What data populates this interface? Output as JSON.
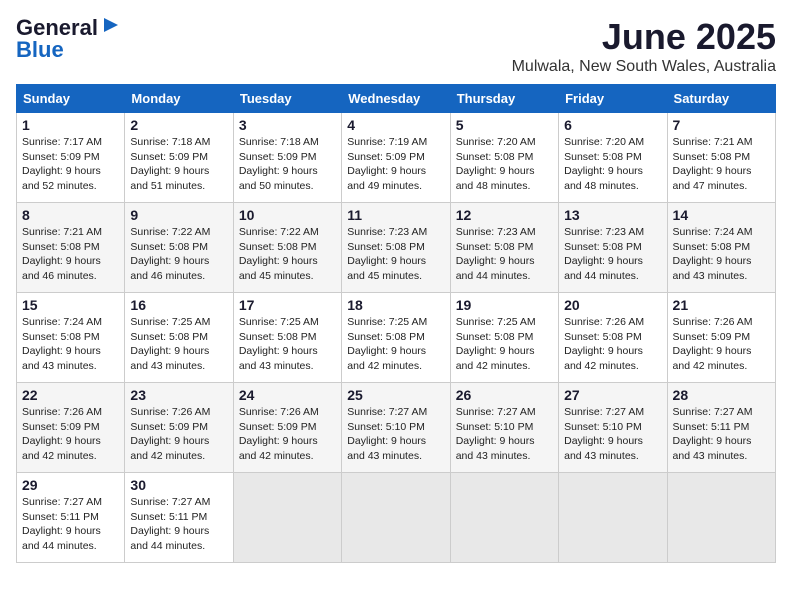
{
  "logo": {
    "general": "General",
    "blue": "Blue"
  },
  "title": "June 2025",
  "location": "Mulwala, New South Wales, Australia",
  "headers": [
    "Sunday",
    "Monday",
    "Tuesday",
    "Wednesday",
    "Thursday",
    "Friday",
    "Saturday"
  ],
  "weeks": [
    [
      {
        "day": "1",
        "sunrise": "7:17 AM",
        "sunset": "5:09 PM",
        "daylight": "9 hours and 52 minutes."
      },
      {
        "day": "2",
        "sunrise": "7:18 AM",
        "sunset": "5:09 PM",
        "daylight": "9 hours and 51 minutes."
      },
      {
        "day": "3",
        "sunrise": "7:18 AM",
        "sunset": "5:09 PM",
        "daylight": "9 hours and 50 minutes."
      },
      {
        "day": "4",
        "sunrise": "7:19 AM",
        "sunset": "5:09 PM",
        "daylight": "9 hours and 49 minutes."
      },
      {
        "day": "5",
        "sunrise": "7:20 AM",
        "sunset": "5:08 PM",
        "daylight": "9 hours and 48 minutes."
      },
      {
        "day": "6",
        "sunrise": "7:20 AM",
        "sunset": "5:08 PM",
        "daylight": "9 hours and 48 minutes."
      },
      {
        "day": "7",
        "sunrise": "7:21 AM",
        "sunset": "5:08 PM",
        "daylight": "9 hours and 47 minutes."
      }
    ],
    [
      {
        "day": "8",
        "sunrise": "7:21 AM",
        "sunset": "5:08 PM",
        "daylight": "9 hours and 46 minutes."
      },
      {
        "day": "9",
        "sunrise": "7:22 AM",
        "sunset": "5:08 PM",
        "daylight": "9 hours and 46 minutes."
      },
      {
        "day": "10",
        "sunrise": "7:22 AM",
        "sunset": "5:08 PM",
        "daylight": "9 hours and 45 minutes."
      },
      {
        "day": "11",
        "sunrise": "7:23 AM",
        "sunset": "5:08 PM",
        "daylight": "9 hours and 45 minutes."
      },
      {
        "day": "12",
        "sunrise": "7:23 AM",
        "sunset": "5:08 PM",
        "daylight": "9 hours and 44 minutes."
      },
      {
        "day": "13",
        "sunrise": "7:23 AM",
        "sunset": "5:08 PM",
        "daylight": "9 hours and 44 minutes."
      },
      {
        "day": "14",
        "sunrise": "7:24 AM",
        "sunset": "5:08 PM",
        "daylight": "9 hours and 43 minutes."
      }
    ],
    [
      {
        "day": "15",
        "sunrise": "7:24 AM",
        "sunset": "5:08 PM",
        "daylight": "9 hours and 43 minutes."
      },
      {
        "day": "16",
        "sunrise": "7:25 AM",
        "sunset": "5:08 PM",
        "daylight": "9 hours and 43 minutes."
      },
      {
        "day": "17",
        "sunrise": "7:25 AM",
        "sunset": "5:08 PM",
        "daylight": "9 hours and 43 minutes."
      },
      {
        "day": "18",
        "sunrise": "7:25 AM",
        "sunset": "5:08 PM",
        "daylight": "9 hours and 42 minutes."
      },
      {
        "day": "19",
        "sunrise": "7:25 AM",
        "sunset": "5:08 PM",
        "daylight": "9 hours and 42 minutes."
      },
      {
        "day": "20",
        "sunrise": "7:26 AM",
        "sunset": "5:08 PM",
        "daylight": "9 hours and 42 minutes."
      },
      {
        "day": "21",
        "sunrise": "7:26 AM",
        "sunset": "5:09 PM",
        "daylight": "9 hours and 42 minutes."
      }
    ],
    [
      {
        "day": "22",
        "sunrise": "7:26 AM",
        "sunset": "5:09 PM",
        "daylight": "9 hours and 42 minutes."
      },
      {
        "day": "23",
        "sunrise": "7:26 AM",
        "sunset": "5:09 PM",
        "daylight": "9 hours and 42 minutes."
      },
      {
        "day": "24",
        "sunrise": "7:26 AM",
        "sunset": "5:09 PM",
        "daylight": "9 hours and 42 minutes."
      },
      {
        "day": "25",
        "sunrise": "7:27 AM",
        "sunset": "5:10 PM",
        "daylight": "9 hours and 43 minutes."
      },
      {
        "day": "26",
        "sunrise": "7:27 AM",
        "sunset": "5:10 PM",
        "daylight": "9 hours and 43 minutes."
      },
      {
        "day": "27",
        "sunrise": "7:27 AM",
        "sunset": "5:10 PM",
        "daylight": "9 hours and 43 minutes."
      },
      {
        "day": "28",
        "sunrise": "7:27 AM",
        "sunset": "5:11 PM",
        "daylight": "9 hours and 43 minutes."
      }
    ],
    [
      {
        "day": "29",
        "sunrise": "7:27 AM",
        "sunset": "5:11 PM",
        "daylight": "9 hours and 44 minutes."
      },
      {
        "day": "30",
        "sunrise": "7:27 AM",
        "sunset": "5:11 PM",
        "daylight": "9 hours and 44 minutes."
      },
      null,
      null,
      null,
      null,
      null
    ]
  ]
}
